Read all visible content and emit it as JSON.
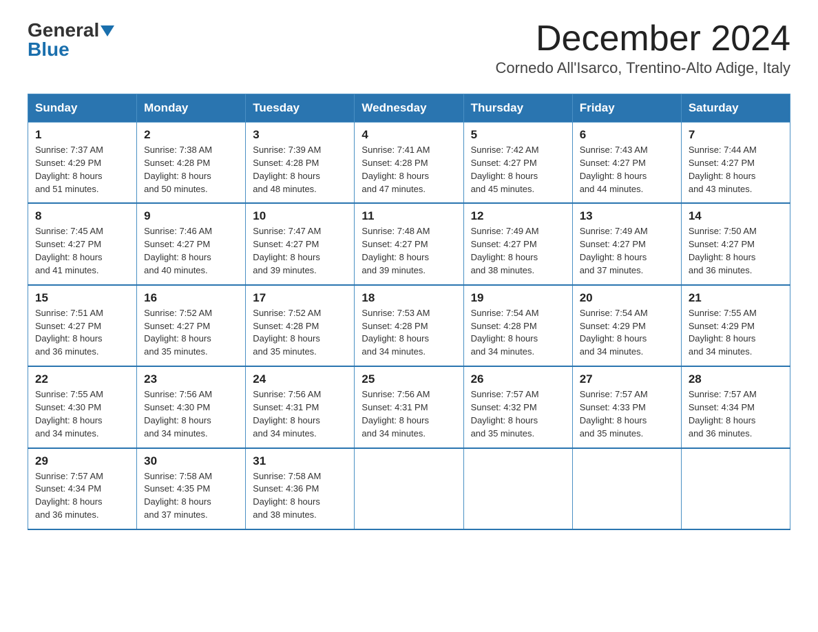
{
  "logo": {
    "general": "General",
    "blue": "Blue"
  },
  "title": "December 2024",
  "subtitle": "Cornedo All'Isarco, Trentino-Alto Adige, Italy",
  "weekdays": [
    "Sunday",
    "Monday",
    "Tuesday",
    "Wednesday",
    "Thursday",
    "Friday",
    "Saturday"
  ],
  "weeks": [
    [
      {
        "day": "1",
        "sunrise": "7:37 AM",
        "sunset": "4:29 PM",
        "daylight": "8 hours and 51 minutes."
      },
      {
        "day": "2",
        "sunrise": "7:38 AM",
        "sunset": "4:28 PM",
        "daylight": "8 hours and 50 minutes."
      },
      {
        "day": "3",
        "sunrise": "7:39 AM",
        "sunset": "4:28 PM",
        "daylight": "8 hours and 48 minutes."
      },
      {
        "day": "4",
        "sunrise": "7:41 AM",
        "sunset": "4:28 PM",
        "daylight": "8 hours and 47 minutes."
      },
      {
        "day": "5",
        "sunrise": "7:42 AM",
        "sunset": "4:27 PM",
        "daylight": "8 hours and 45 minutes."
      },
      {
        "day": "6",
        "sunrise": "7:43 AM",
        "sunset": "4:27 PM",
        "daylight": "8 hours and 44 minutes."
      },
      {
        "day": "7",
        "sunrise": "7:44 AM",
        "sunset": "4:27 PM",
        "daylight": "8 hours and 43 minutes."
      }
    ],
    [
      {
        "day": "8",
        "sunrise": "7:45 AM",
        "sunset": "4:27 PM",
        "daylight": "8 hours and 41 minutes."
      },
      {
        "day": "9",
        "sunrise": "7:46 AM",
        "sunset": "4:27 PM",
        "daylight": "8 hours and 40 minutes."
      },
      {
        "day": "10",
        "sunrise": "7:47 AM",
        "sunset": "4:27 PM",
        "daylight": "8 hours and 39 minutes."
      },
      {
        "day": "11",
        "sunrise": "7:48 AM",
        "sunset": "4:27 PM",
        "daylight": "8 hours and 39 minutes."
      },
      {
        "day": "12",
        "sunrise": "7:49 AM",
        "sunset": "4:27 PM",
        "daylight": "8 hours and 38 minutes."
      },
      {
        "day": "13",
        "sunrise": "7:49 AM",
        "sunset": "4:27 PM",
        "daylight": "8 hours and 37 minutes."
      },
      {
        "day": "14",
        "sunrise": "7:50 AM",
        "sunset": "4:27 PM",
        "daylight": "8 hours and 36 minutes."
      }
    ],
    [
      {
        "day": "15",
        "sunrise": "7:51 AM",
        "sunset": "4:27 PM",
        "daylight": "8 hours and 36 minutes."
      },
      {
        "day": "16",
        "sunrise": "7:52 AM",
        "sunset": "4:27 PM",
        "daylight": "8 hours and 35 minutes."
      },
      {
        "day": "17",
        "sunrise": "7:52 AM",
        "sunset": "4:28 PM",
        "daylight": "8 hours and 35 minutes."
      },
      {
        "day": "18",
        "sunrise": "7:53 AM",
        "sunset": "4:28 PM",
        "daylight": "8 hours and 34 minutes."
      },
      {
        "day": "19",
        "sunrise": "7:54 AM",
        "sunset": "4:28 PM",
        "daylight": "8 hours and 34 minutes."
      },
      {
        "day": "20",
        "sunrise": "7:54 AM",
        "sunset": "4:29 PM",
        "daylight": "8 hours and 34 minutes."
      },
      {
        "day": "21",
        "sunrise": "7:55 AM",
        "sunset": "4:29 PM",
        "daylight": "8 hours and 34 minutes."
      }
    ],
    [
      {
        "day": "22",
        "sunrise": "7:55 AM",
        "sunset": "4:30 PM",
        "daylight": "8 hours and 34 minutes."
      },
      {
        "day": "23",
        "sunrise": "7:56 AM",
        "sunset": "4:30 PM",
        "daylight": "8 hours and 34 minutes."
      },
      {
        "day": "24",
        "sunrise": "7:56 AM",
        "sunset": "4:31 PM",
        "daylight": "8 hours and 34 minutes."
      },
      {
        "day": "25",
        "sunrise": "7:56 AM",
        "sunset": "4:31 PM",
        "daylight": "8 hours and 34 minutes."
      },
      {
        "day": "26",
        "sunrise": "7:57 AM",
        "sunset": "4:32 PM",
        "daylight": "8 hours and 35 minutes."
      },
      {
        "day": "27",
        "sunrise": "7:57 AM",
        "sunset": "4:33 PM",
        "daylight": "8 hours and 35 minutes."
      },
      {
        "day": "28",
        "sunrise": "7:57 AM",
        "sunset": "4:34 PM",
        "daylight": "8 hours and 36 minutes."
      }
    ],
    [
      {
        "day": "29",
        "sunrise": "7:57 AM",
        "sunset": "4:34 PM",
        "daylight": "8 hours and 36 minutes."
      },
      {
        "day": "30",
        "sunrise": "7:58 AM",
        "sunset": "4:35 PM",
        "daylight": "8 hours and 37 minutes."
      },
      {
        "day": "31",
        "sunrise": "7:58 AM",
        "sunset": "4:36 PM",
        "daylight": "8 hours and 38 minutes."
      },
      null,
      null,
      null,
      null
    ]
  ],
  "labels": {
    "sunrise": "Sunrise: ",
    "sunset": "Sunset: ",
    "daylight": "Daylight: "
  }
}
